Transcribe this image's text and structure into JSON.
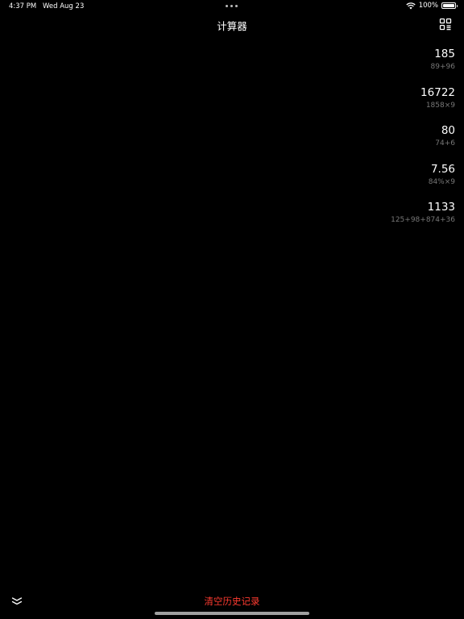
{
  "status_bar": {
    "time": "4:37 PM",
    "date": "Wed Aug 23",
    "battery": "100%"
  },
  "header": {
    "title": "计算器",
    "qr_icon": "qr-code-icon"
  },
  "history": [
    {
      "result": "185",
      "expression": "89+96"
    },
    {
      "result": "16722",
      "expression": "1858×9"
    },
    {
      "result": "80",
      "expression": "74+6"
    },
    {
      "result": "7.56",
      "expression": "84%×9"
    },
    {
      "result": "1133",
      "expression": "125+98+874+36"
    }
  ],
  "footer": {
    "clear_label": "清空历史记录",
    "collapse_icon": "double-chevron-down-icon"
  },
  "colors": {
    "background": "#000000",
    "accent": "#ff3b30",
    "secondary_text": "#777777"
  }
}
